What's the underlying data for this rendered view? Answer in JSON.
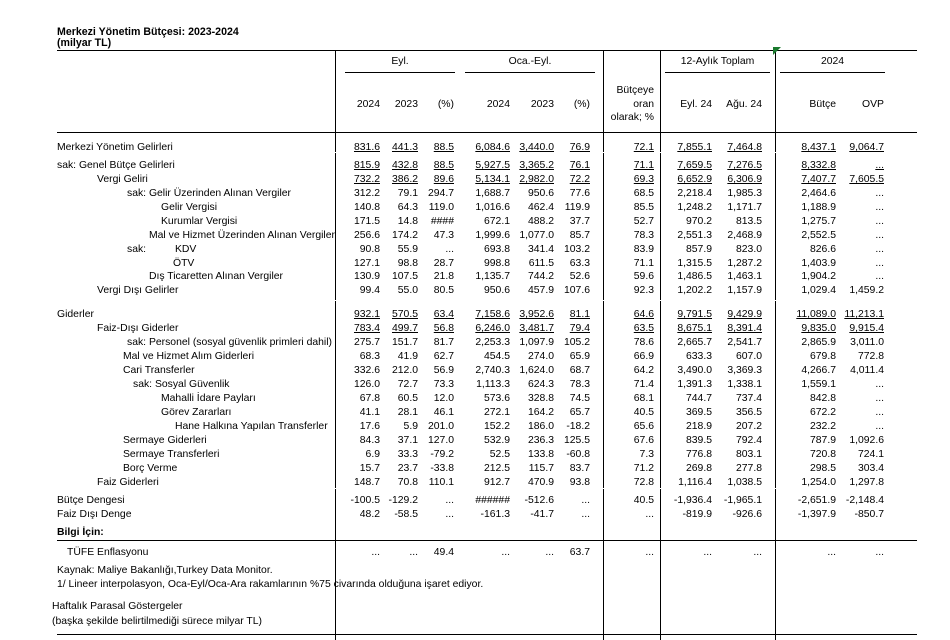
{
  "title": "Merkezi Yönetim Bütçesi: 2023-2024",
  "subtitle": "(milyar TL)",
  "groups": {
    "eyl": "Eyl.",
    "oca_eyl": "Oca.-Eyl.",
    "aylik12": "12-Aylık Toplam",
    "y2024": "2024"
  },
  "col_headers": {
    "a2024": "2024",
    "a2023": "2023",
    "apct": "(%)",
    "b2024": "2024",
    "b2023": "2023",
    "bpct": "(%)",
    "ratio_l1": "Bütçeye",
    "ratio_l2": "oran",
    "ratio_l3": "olarak; %",
    "eyl24": "Eyl. 24",
    "agu24": "Ağu. 24",
    "butce": "Bütçe",
    "ovp": "OVP"
  },
  "rows": [
    {
      "label": "Merkezi Yönetim Gelirleri",
      "v": [
        "831.6",
        "441.3",
        "88.5",
        "6,084.6",
        "3,440.0",
        "76.9",
        "72.1",
        "7,855.1",
        "7,464.8",
        "8,437.1",
        "9,064.7"
      ],
      "u": true
    },
    {
      "label": "sak:  Genel Bütçe Gelirleri",
      "v": [
        "815.9",
        "432.8",
        "88.5",
        "5,927.5",
        "3,365.2",
        "76.1",
        "71.1",
        "7,659.5",
        "7,276.5",
        "8,332.8",
        "..."
      ],
      "u": true
    },
    {
      "label": "Vergi Geliri",
      "v": [
        "732.2",
        "386.2",
        "89.6",
        "5,134.1",
        "2,982.0",
        "72.2",
        "69.3",
        "6,652.9",
        "6,306.9",
        "7,407.7",
        "7,605.5"
      ],
      "u": true
    },
    {
      "label": "sak:  Gelir Üzerinden Alınan Vergiler",
      "v": [
        "312.2",
        "79.1",
        "294.7",
        "1,688.7",
        "950.6",
        "77.6",
        "68.5",
        "2,218.4",
        "1,985.3",
        "2,464.6",
        "..."
      ]
    },
    {
      "label": "Gelir Vergisi",
      "v": [
        "140.8",
        "64.3",
        "119.0",
        "1,016.6",
        "462.4",
        "119.9",
        "85.5",
        "1,248.2",
        "1,171.7",
        "1,188.9",
        "..."
      ]
    },
    {
      "label": "Kurumlar Vergisi",
      "v": [
        "171.5",
        "14.8",
        "####",
        "672.1",
        "488.2",
        "37.7",
        "52.7",
        "970.2",
        "813.5",
        "1,275.7",
        "..."
      ]
    },
    {
      "label": "Mal ve Hizmet Üzerinden Alınan Vergiler",
      "v": [
        "256.6",
        "174.2",
        "47.3",
        "1,999.6",
        "1,077.0",
        "85.7",
        "78.3",
        "2,551.3",
        "2,468.9",
        "2,552.5",
        "..."
      ]
    },
    {
      "label": "sak:",
      "label2": "KDV",
      "v": [
        "90.8",
        "55.9",
        "...",
        "693.8",
        "341.4",
        "103.2",
        "83.9",
        "857.9",
        "823.0",
        "826.6",
        "..."
      ]
    },
    {
      "label": "ÖTV",
      "v": [
        "127.1",
        "98.8",
        "28.7",
        "998.8",
        "611.5",
        "63.3",
        "71.1",
        "1,315.5",
        "1,287.2",
        "1,403.9",
        "..."
      ]
    },
    {
      "label": "Dış Ticaretten Alınan Vergiler",
      "v": [
        "130.9",
        "107.5",
        "21.8",
        "1,135.7",
        "744.2",
        "52.6",
        "59.6",
        "1,486.5",
        "1,463.1",
        "1,904.2",
        "..."
      ]
    },
    {
      "label": "Vergi Dışı Gelirler",
      "v": [
        "99.4",
        "55.0",
        "80.5",
        "950.6",
        "457.9",
        "107.6",
        "92.3",
        "1,202.2",
        "1,157.9",
        "1,029.4",
        "1,459.2"
      ]
    },
    {
      "label": "Giderler",
      "v": [
        "932.1",
        "570.5",
        "63.4",
        "7,158.6",
        "3,952.6",
        "81.1",
        "64.6",
        "9,791.5",
        "9,429.9",
        "11,089.0",
        "11,213.1"
      ],
      "u": true
    },
    {
      "label": "Faiz-Dışı Giderler",
      "v": [
        "783.4",
        "499.7",
        "56.8",
        "6,246.0",
        "3,481.7",
        "79.4",
        "63.5",
        "8,675.1",
        "8,391.4",
        "9,835.0",
        "9,915.4"
      ],
      "u": true
    },
    {
      "label": "sak: Personel (sosyal güvenlik primleri dahil)",
      "v": [
        "275.7",
        "151.7",
        "81.7",
        "2,253.3",
        "1,097.9",
        "105.2",
        "78.6",
        "2,665.7",
        "2,541.7",
        "2,865.9",
        "3,011.0"
      ]
    },
    {
      "label": "Mal ve Hizmet Alım Giderleri",
      "v": [
        "68.3",
        "41.9",
        "62.7",
        "454.5",
        "274.0",
        "65.9",
        "66.9",
        "633.3",
        "607.0",
        "679.8",
        "772.8"
      ]
    },
    {
      "label": "Cari Transferler",
      "v": [
        "332.6",
        "212.0",
        "56.9",
        "2,740.3",
        "1,624.0",
        "68.7",
        "64.2",
        "3,490.0",
        "3,369.3",
        "4,266.7",
        "4,011.4"
      ]
    },
    {
      "label": "sak: Sosyal Güvenlik",
      "v": [
        "126.0",
        "72.7",
        "73.3",
        "1,113.3",
        "624.3",
        "78.3",
        "71.4",
        "1,391.3",
        "1,338.1",
        "1,559.1",
        "..."
      ]
    },
    {
      "label": "Mahalli İdare Payları",
      "v": [
        "67.8",
        "60.5",
        "12.0",
        "573.6",
        "328.8",
        "74.5",
        "68.1",
        "744.7",
        "737.4",
        "842.8",
        "..."
      ]
    },
    {
      "label": "Görev Zararları",
      "v": [
        "41.1",
        "28.1",
        "46.1",
        "272.1",
        "164.2",
        "65.7",
        "40.5",
        "369.5",
        "356.5",
        "672.2",
        "..."
      ]
    },
    {
      "label": "Hane Halkına Yapılan Transferler",
      "v": [
        "17.6",
        "5.9",
        "201.0",
        "152.2",
        "186.0",
        "-18.2",
        "65.6",
        "218.9",
        "207.2",
        "232.2",
        "..."
      ]
    },
    {
      "label": "Sermaye Giderleri",
      "v": [
        "84.3",
        "37.1",
        "127.0",
        "532.9",
        "236.3",
        "125.5",
        "67.6",
        "839.5",
        "792.4",
        "787.9",
        "1,092.6"
      ]
    },
    {
      "label": "Sermaye Transferleri",
      "v": [
        "6.9",
        "33.3",
        "-79.2",
        "52.5",
        "133.8",
        "-60.8",
        "7.3",
        "776.8",
        "803.1",
        "720.8",
        "724.1"
      ]
    },
    {
      "label": "Borç Verme",
      "v": [
        "15.7",
        "23.7",
        "-33.8",
        "212.5",
        "115.7",
        "83.7",
        "71.2",
        "269.8",
        "277.8",
        "298.5",
        "303.4"
      ]
    },
    {
      "label": "Faiz Giderleri",
      "v": [
        "148.7",
        "70.8",
        "110.1",
        "912.7",
        "470.9",
        "93.8",
        "72.8",
        "1,116.4",
        "1,038.5",
        "1,254.0",
        "1,297.8"
      ]
    },
    {
      "label": "Bütçe Dengesi",
      "v": [
        "-100.5",
        "-129.2",
        "...",
        "######",
        "-512.6",
        "...",
        "40.5",
        "-1,936.4",
        "-1,965.1",
        "-2,651.9",
        "-2,148.4"
      ]
    },
    {
      "label": "Faiz Dışı Denge",
      "v": [
        "48.2",
        "-58.5",
        "...",
        "-161.3",
        "-41.7",
        "...",
        "...",
        "-819.9",
        "-926.6",
        "-1,397.9",
        "-850.7"
      ]
    }
  ],
  "info_label": "Bilgi İçin:",
  "tufe": {
    "label": "TÜFE Enflasyonu",
    "v": [
      "...",
      "...",
      "49.4",
      "...",
      "...",
      "63.7",
      "...",
      "...",
      "...",
      "...",
      "..."
    ]
  },
  "footnotes": {
    "source": "Kaynak: Maliye Bakanlığı,Turkey Data Monitor.",
    "note1": "1/ Lineer interpolasyon, Oca-Eyl/Oca-Ara rakamlarının %75 civarında olduğuna işaret ediyor.",
    "weekly": "Haftalık Parasal Göstergeler",
    "weekly_sub": "(başka şekilde belirtilmediği sürece milyar TL)"
  }
}
